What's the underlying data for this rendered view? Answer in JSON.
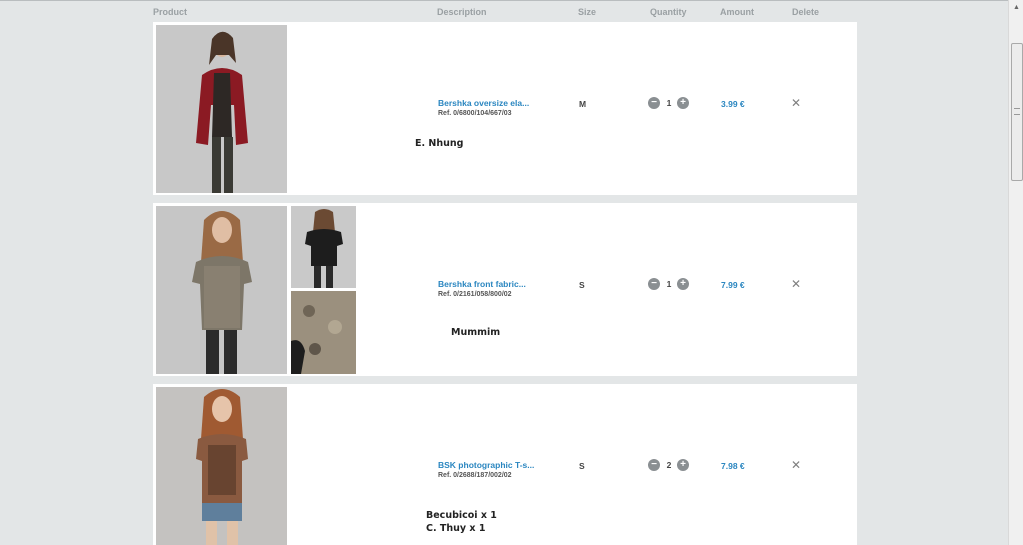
{
  "header": {
    "product": "Product",
    "description": "Description",
    "size": "Size",
    "quantity": "Quantity",
    "amount": "Amount",
    "delete": "Delete"
  },
  "items": [
    {
      "name": "Bershka oversize ela...",
      "ref": "Ref. 0/6800/104/667/03",
      "size": "M",
      "quantity": "1",
      "amount": "3.99 €",
      "note": [
        "E. Nhung"
      ]
    },
    {
      "name": "Bershka front fabric...",
      "ref": "Ref. 0/2161/058/800/02",
      "size": "S",
      "quantity": "1",
      "amount": "7.99 €",
      "note": [
        "Mummim"
      ]
    },
    {
      "name": "BSK photographic T-s...",
      "ref": "Ref. 0/2688/187/002/02",
      "size": "S",
      "quantity": "2",
      "amount": "7.98 €",
      "note": [
        "Becubicoi x 1",
        "C. Thuy x 1"
      ]
    }
  ],
  "controls": {
    "minus": "−",
    "plus": "+",
    "delete": "✕",
    "scroll_up": "▲"
  },
  "colors": {
    "background": "#e3e6e7",
    "link": "#2a86c0",
    "header_text": "#9aa0a3"
  }
}
